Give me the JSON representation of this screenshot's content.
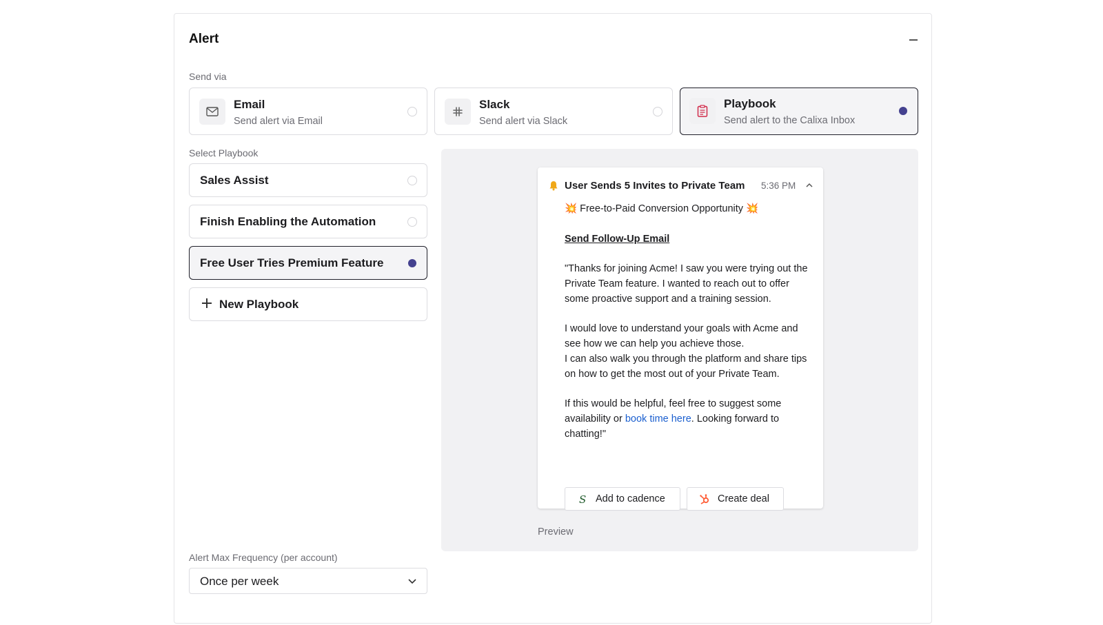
{
  "alert": {
    "title": "Alert",
    "send_via_label": "Send via",
    "send_options": [
      {
        "title": "Email",
        "subtitle": "Send alert via Email",
        "icon": "mail-icon",
        "selected": false
      },
      {
        "title": "Slack",
        "subtitle": "Send alert via Slack",
        "icon": "slack-icon",
        "selected": false
      },
      {
        "title": "Playbook",
        "subtitle": "Send alert to the Calixa Inbox",
        "icon": "clipboard-icon",
        "selected": true
      }
    ],
    "select_playbook_label": "Select Playbook",
    "playbooks": [
      {
        "label": "Sales Assist",
        "selected": false
      },
      {
        "label": "Finish Enabling the Automation",
        "selected": false
      },
      {
        "label": "Free User Tries Premium Feature",
        "selected": true
      }
    ],
    "new_playbook_label": "New Playbook",
    "frequency_label": "Alert Max Frequency (per account)",
    "frequency_value": "Once per week"
  },
  "preview": {
    "label": "Preview",
    "card": {
      "title": "User Sends 5 Invites to Private Team",
      "time": "5:36 PM",
      "headline_emoji": "💥",
      "headline": "Free-to-Paid Conversion Opportunity",
      "section_link": "Send Follow-Up Email",
      "paragraph_1": "\"Thanks for joining Acme! I saw you were trying out the Private Team feature. I wanted to reach out to offer some proactive support and a training session.",
      "paragraph_2a": "I would love to understand your goals with Acme and see how we can help you achieve those.",
      "paragraph_2b": "I can also walk you through the platform and share tips on how to get the most out of your Private Team.",
      "paragraph_3_pre": "If this would be helpful, feel free to suggest some availability or ",
      "paragraph_3_link": "book time here",
      "paragraph_3_post": ". Looking forward to chatting!\"",
      "add_to_cadence_label": "Add to cadence",
      "create_deal_label": "Create deal"
    }
  },
  "colors": {
    "accent": "#44418f",
    "link": "#1b5fcf",
    "bell": "#f0a818",
    "clipboard": "#d02a4a",
    "hubspot": "#ff5c35",
    "salesloft": "#1f5a2a"
  }
}
